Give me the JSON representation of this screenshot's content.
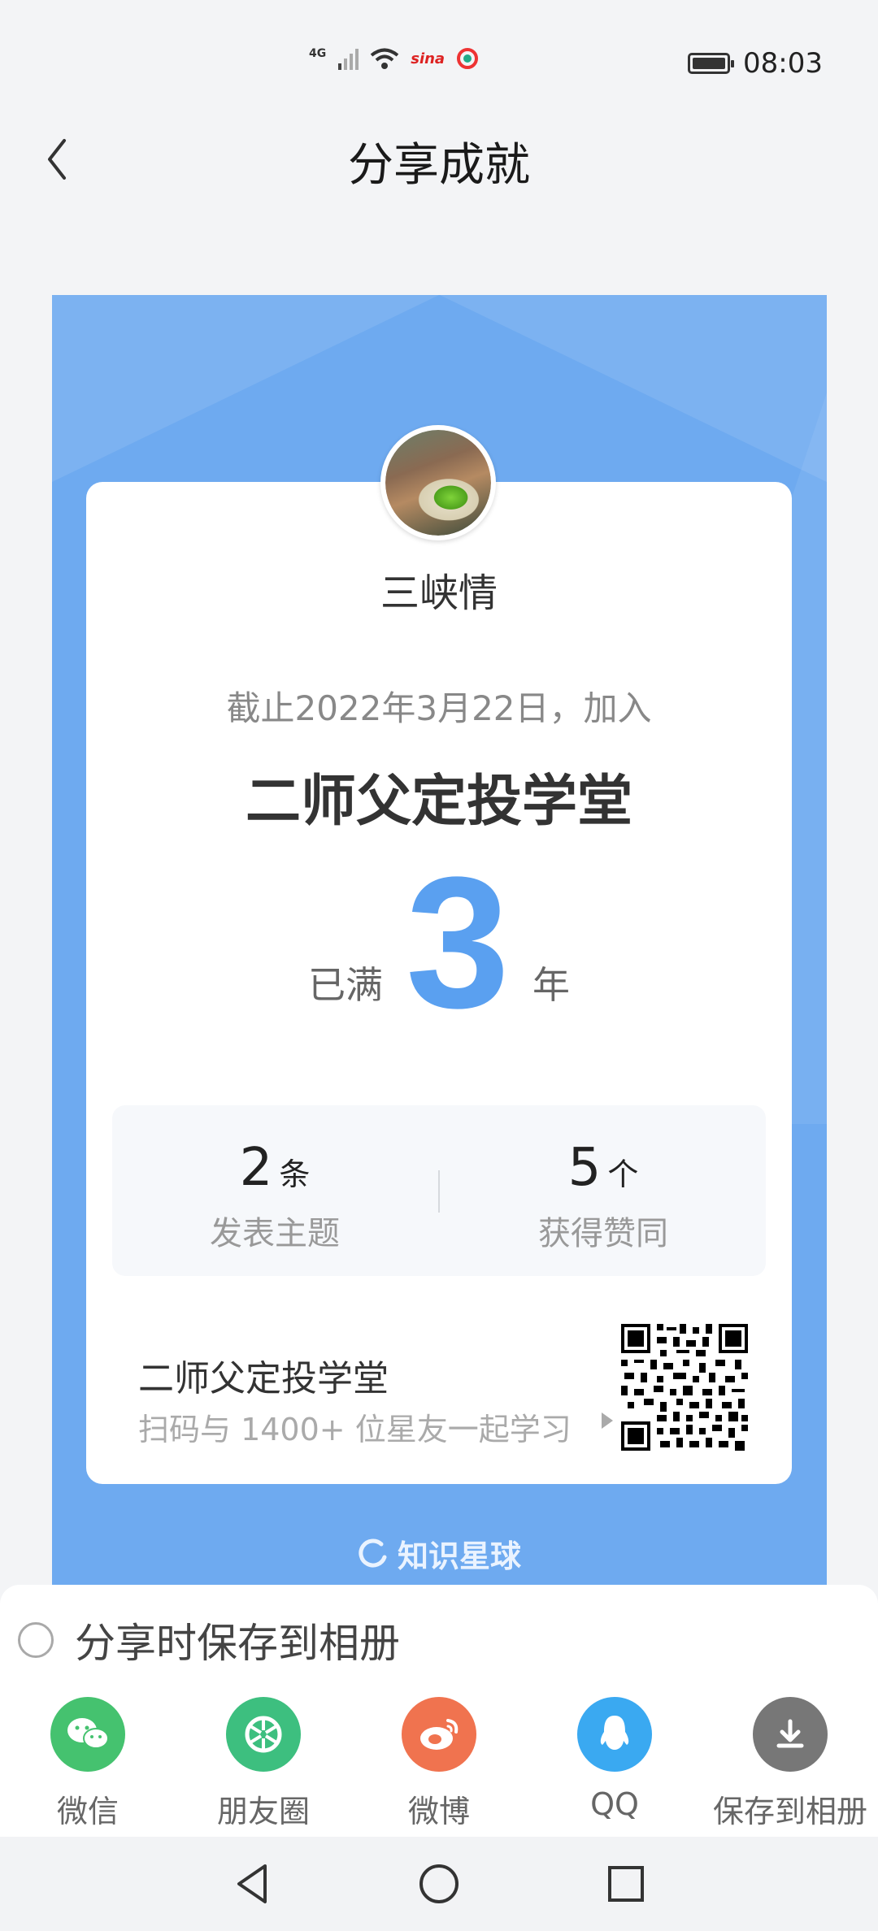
{
  "status_bar": {
    "network": "4G",
    "sina_label": "sina",
    "time": "08:03"
  },
  "header": {
    "title": "分享成就"
  },
  "card": {
    "user_name": "三峡情",
    "since_text": "截止2022年3月22日，加入",
    "group_name": "二师父定投学堂",
    "years_prefix": "已满",
    "years": "3",
    "years_unit": "年",
    "stats": [
      {
        "value": "2",
        "unit": "条",
        "label": "发表主题"
      },
      {
        "value": "5",
        "unit": "个",
        "label": "获得赞同"
      }
    ],
    "footer_title": "二师父定投学堂",
    "footer_subtitle": "扫码与 1400+ 位星友一起学习",
    "brand": "知识星球",
    "colors": {
      "card_bg": "#6eaaf0",
      "years_accent": "#5aa0f0"
    }
  },
  "sheet": {
    "save_option_label": "分享时保存到相册",
    "share_targets": [
      {
        "label": "微信",
        "icon": "wechat-icon",
        "color": "#45c26f"
      },
      {
        "label": "朋友圈",
        "icon": "moments-icon",
        "color": "#3dbf7f"
      },
      {
        "label": "微博",
        "icon": "weibo-icon",
        "color": "#f0734f"
      },
      {
        "label": "QQ",
        "icon": "qq-icon",
        "color": "#3aa9f1"
      },
      {
        "label": "保存到相册",
        "icon": "download-icon",
        "color": "#777777"
      }
    ]
  }
}
